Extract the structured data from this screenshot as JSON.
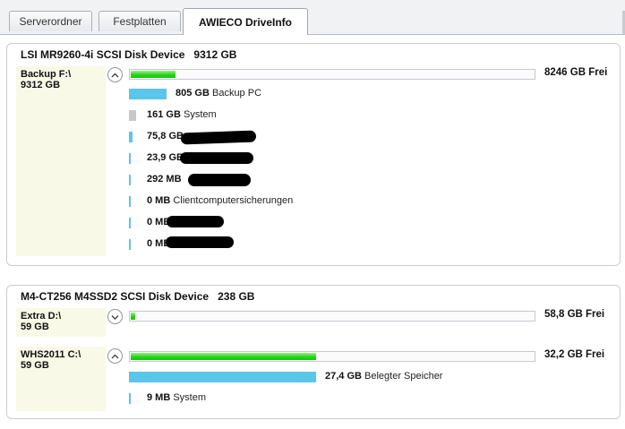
{
  "tabs": [
    {
      "label": "Serverordner"
    },
    {
      "label": "Festplatten"
    },
    {
      "label": "AWIECO DriveInfo"
    }
  ],
  "colors": {
    "used": "#1fd01a",
    "item_blue": "#5ac6ec",
    "item_gray": "#c8c8c8",
    "panel_bg": "#f8f9e6"
  },
  "disks": [
    {
      "name": "LSI MR9260-4i SCSI Disk Device",
      "size": "9312 GB",
      "volumes": [
        {
          "name": "Backup F:\\",
          "size": "9312 GB",
          "free": "8246 GB Frei",
          "used_fraction": 0.11,
          "expanded": true,
          "items": [
            {
              "size": "805 GB",
              "label": "Backup PC",
              "fraction": 0.092,
              "color": "#5ac6ec"
            },
            {
              "size": "161 GB",
              "label": "System",
              "fraction": 0.018,
              "color": "#c8c8c8"
            },
            {
              "size": "75,8 GB",
              "label": "",
              "fraction": 0.008,
              "color": "#5ac6ec"
            },
            {
              "size": "23,9 GB",
              "label": "",
              "fraction": 0.003,
              "color": "#5ac6ec"
            },
            {
              "size": "292 MB",
              "label": "",
              "fraction": 0.0,
              "color": "#5ac6ec"
            },
            {
              "size": "0 MB",
              "label": "Clientcomputersicherungen",
              "fraction": 0.0,
              "color": "#5ac6ec"
            },
            {
              "size": "0 MB",
              "label": "",
              "fraction": 0.0,
              "color": "#5ac6ec"
            },
            {
              "size": "0 MB",
              "label": "",
              "fraction": 0.0,
              "color": "#5ac6ec"
            }
          ]
        }
      ]
    },
    {
      "name": "M4-CT256 M4SSD2 SCSI Disk Device",
      "size": "238 GB",
      "volumes": [
        {
          "name": "Extra D:\\",
          "size": "59 GB",
          "free": "58,8 GB Frei",
          "used_fraction": 0.01,
          "expanded": false,
          "items": []
        },
        {
          "name": "WHS2011 C:\\",
          "size": "59 GB",
          "free": "32,2 GB Frei",
          "used_fraction": 0.46,
          "expanded": true,
          "items": [
            {
              "size": "27,4 GB",
              "label": "Belegter Speicher",
              "fraction": 0.46,
              "color": "#5ac6ec"
            },
            {
              "size": "9 MB",
              "label": "System",
              "fraction": 0.0,
              "color": "#5ac6ec"
            }
          ]
        }
      ]
    }
  ]
}
